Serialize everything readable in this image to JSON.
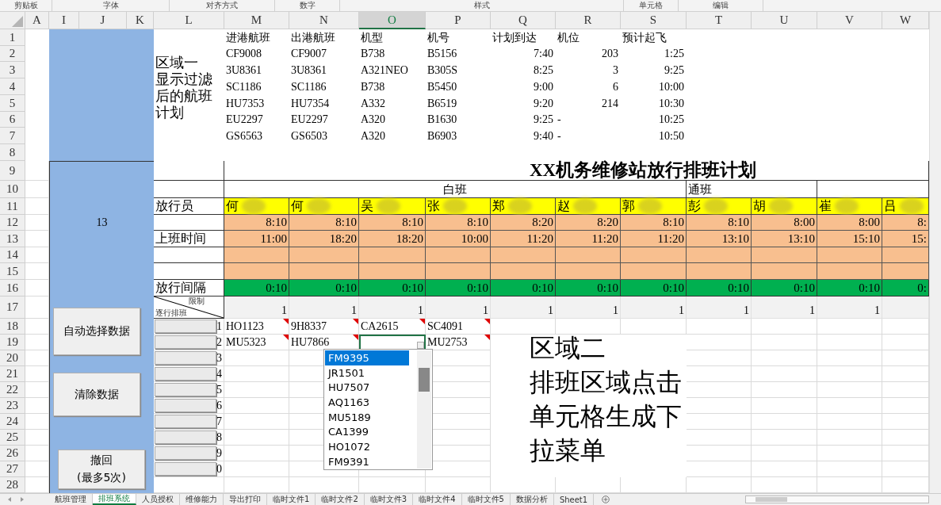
{
  "ribbon": {
    "groups": [
      "剪贴板",
      "字体",
      "对齐方式",
      "数字",
      "样式",
      "单元格",
      "编辑"
    ]
  },
  "column_headers": [
    {
      "label": "A",
      "selected": false
    },
    {
      "label": "I",
      "selected": false
    },
    {
      "label": "J",
      "selected": false
    },
    {
      "label": "K",
      "selected": false
    },
    {
      "label": "L",
      "selected": false
    },
    {
      "label": "M",
      "selected": false
    },
    {
      "label": "N",
      "selected": false
    },
    {
      "label": "O",
      "selected": true
    },
    {
      "label": "P",
      "selected": false
    },
    {
      "label": "Q",
      "selected": false
    },
    {
      "label": "R",
      "selected": false
    },
    {
      "label": "S",
      "selected": false
    },
    {
      "label": "T",
      "selected": false
    },
    {
      "label": "U",
      "selected": false
    },
    {
      "label": "V",
      "selected": false
    },
    {
      "label": "W",
      "selected": false
    }
  ],
  "row_numbers": [
    "1",
    "2",
    "3",
    "4",
    "5",
    "6",
    "7",
    "8",
    "9",
    "10",
    "11",
    "12",
    "13",
    "14",
    "15",
    "16",
    "17",
    "18",
    "19",
    "20",
    "21",
    "22",
    "23",
    "24",
    "25",
    "26",
    "27",
    "28"
  ],
  "flight_plan": {
    "columns": [
      "进港航班",
      "出港航班",
      "机型",
      "机号",
      "计划到达",
      "机位",
      "预计起飞"
    ],
    "rows": [
      [
        "CF9008",
        "CF9007",
        "B738",
        "B5156",
        "7:40",
        "203",
        "1:25"
      ],
      [
        "3U8361",
        "3U8361",
        "A321NEO",
        "B305S",
        "8:25",
        "3",
        "9:25"
      ],
      [
        "SC1186",
        "SC1186",
        "B738",
        "B5450",
        "9:00",
        "6",
        "10:00"
      ],
      [
        "HU7353",
        "HU7354",
        "A332",
        "B6519",
        "9:20",
        "214",
        "10:30"
      ],
      [
        "EU2297",
        "EU2297",
        "A320",
        "B1630",
        "9:25",
        "-",
        "10:25"
      ],
      [
        "GS6563",
        "GS6503",
        "A320",
        "B6903",
        "9:40",
        "-",
        "10:50"
      ]
    ]
  },
  "note_1": {
    "lines": [
      "区域一",
      "显示过滤",
      "后的航班",
      "计划"
    ]
  },
  "side_panel": {
    "count": "13",
    "buttons": [
      {
        "lines": [
          "自动选择数据"
        ]
      },
      {
        "lines": [
          "清除数据"
        ]
      },
      {
        "lines": [
          "撤回",
          "(最多5次)"
        ]
      }
    ]
  },
  "schedule": {
    "title": "XX机务维修站放行排班计划",
    "labels": {
      "staff": "放行员",
      "shift_time": "上班时间",
      "interval": "放行间隔",
      "corner_top": "限制",
      "corner_bottom": "逐行排班"
    },
    "shifts": [
      {
        "label": "白班",
        "staff": [
          {
            "name": "何",
            "start": "8:10",
            "end": "11:00",
            "interval": "0:10",
            "limit": "1"
          },
          {
            "name": "何",
            "start": "8:10",
            "end": "18:20",
            "interval": "0:10",
            "limit": "1"
          },
          {
            "name": "吴",
            "start": "8:10",
            "end": "18:20",
            "interval": "0:10",
            "limit": "1"
          },
          {
            "name": "张",
            "start": "8:10",
            "end": "10:00",
            "interval": "0:10",
            "limit": "1"
          },
          {
            "name": "郑",
            "start": "8:20",
            "end": "11:20",
            "interval": "0:10",
            "limit": "1"
          },
          {
            "name": "赵",
            "start": "8:20",
            "end": "11:20",
            "interval": "0:10",
            "limit": "1"
          },
          {
            "name": "郭",
            "start": "8:10",
            "end": "11:20",
            "interval": "0:10",
            "limit": "1"
          }
        ]
      },
      {
        "label": "通班",
        "staff": [
          {
            "name": "彭",
            "start": "8:10",
            "end": "13:10",
            "interval": "0:10",
            "limit": "1"
          },
          {
            "name": "胡",
            "start": "8:00",
            "end": "13:10",
            "interval": "0:10",
            "limit": "1"
          }
        ]
      },
      {
        "staff": [
          {
            "name": "崔",
            "start": "8:00",
            "end": "15:10",
            "interval": "0:10",
            "limit": "1"
          },
          {
            "name": "吕",
            "start": "8:",
            "end": "15:",
            "interval": "0:"
          }
        ]
      }
    ]
  },
  "assignment_rows": [
    {
      "number": "1",
      "cells": [
        {
          "flight": "HO1123",
          "comment": true,
          "selected": false
        },
        {
          "flight": "9H8337",
          "comment": true,
          "selected": false
        },
        {
          "flight": "CA2615",
          "comment": true,
          "selected": false
        },
        {
          "flight": "SC4091",
          "comment": true,
          "selected": false
        }
      ]
    },
    {
      "number": "2",
      "cells": [
        {
          "flight": "MU5323",
          "comment": true,
          "selected": false
        },
        {
          "flight": "HU7866",
          "comment": true,
          "selected": false
        },
        {
          "comment": false,
          "selected": true
        },
        {
          "flight": "MU2753",
          "comment": true,
          "selected": false
        }
      ]
    },
    {
      "number": "3"
    },
    {
      "number": "4"
    },
    {
      "number": "5"
    },
    {
      "number": "6"
    },
    {
      "number": "7"
    },
    {
      "number": "8"
    },
    {
      "number": "9"
    },
    {
      "number": "0"
    }
  ],
  "dropdown": {
    "items": [
      {
        "label": "FM9395",
        "selected": true
      },
      {
        "label": "JR1501",
        "selected": false
      },
      {
        "label": "HU7507",
        "selected": false
      },
      {
        "label": "AQ1163",
        "selected": false
      },
      {
        "label": "MU5189",
        "selected": false
      },
      {
        "label": "CA1399",
        "selected": false
      },
      {
        "label": "HO1072",
        "selected": false
      },
      {
        "label": "FM9391",
        "selected": false
      }
    ]
  },
  "note_2": {
    "lines": [
      "区域二",
      "排班区域点击",
      "单元格生成下",
      "拉菜单"
    ]
  },
  "sheet_tabs": [
    {
      "label": "航班管理",
      "selected": false
    },
    {
      "label": "排班系统",
      "selected": true
    },
    {
      "label": "人员授权",
      "selected": false
    },
    {
      "label": "维修能力",
      "selected": false
    },
    {
      "label": "导出打印",
      "selected": false
    },
    {
      "label": "临时文件1",
      "selected": false
    },
    {
      "label": "临时文件2",
      "selected": false
    },
    {
      "label": "临时文件3",
      "selected": false
    },
    {
      "label": "临时文件4",
      "selected": false
    },
    {
      "label": "临时文件5",
      "selected": false
    },
    {
      "label": "数据分析",
      "selected": false
    },
    {
      "label": "Sheet1",
      "selected": false
    }
  ]
}
